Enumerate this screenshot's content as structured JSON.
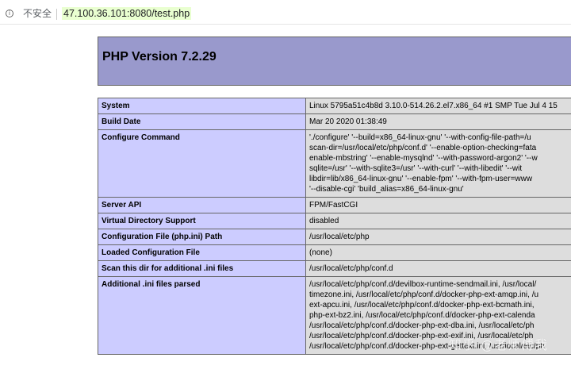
{
  "browser": {
    "security_label": "不安全",
    "url": "47.100.36.101:8080/test.php"
  },
  "page": {
    "title": "PHP Version 7.2.29",
    "rows": [
      {
        "key": "System",
        "value": "Linux 5795a51c4b8d 3.10.0-514.26.2.el7.x86_64 #1 SMP Tue Jul 4 15"
      },
      {
        "key": "Build Date",
        "value": "Mar 20 2020 01:38:49"
      },
      {
        "key": "Configure Command",
        "value": "'./configure' '--build=x86_64-linux-gnu' '--with-config-file-path=/u\nscan-dir=/usr/local/etc/php/conf.d' '--enable-option-checking=fata\nenable-mbstring' '--enable-mysqlnd' '--with-password-argon2' '--w\nsqlite=/usr' '--with-sqlite3=/usr' '--with-curl' '--with-libedit' '--wit\nlibdir=lib/x86_64-linux-gnu' '--enable-fpm' '--with-fpm-user=www\n'--disable-cgi' 'build_alias=x86_64-linux-gnu'"
      },
      {
        "key": "Server API",
        "value": "FPM/FastCGI"
      },
      {
        "key": "Virtual Directory Support",
        "value": "disabled"
      },
      {
        "key": "Configuration File (php.ini) Path",
        "value": "/usr/local/etc/php"
      },
      {
        "key": "Loaded Configuration File",
        "value": "(none)"
      },
      {
        "key": "Scan this dir for additional .ini files",
        "value": "/usr/local/etc/php/conf.d"
      },
      {
        "key": "Additional .ini files parsed",
        "value": "/usr/local/etc/php/conf.d/devilbox-runtime-sendmail.ini, /usr/local/\ntimezone.ini, /usr/local/etc/php/conf.d/docker-php-ext-amqp.ini, /u\next-apcu.ini, /usr/local/etc/php/conf.d/docker-php-ext-bcmath.ini,\nphp-ext-bz2.ini, /usr/local/etc/php/conf.d/docker-php-ext-calenda\n/usr/local/etc/php/conf.d/docker-php-ext-dba.ini, /usr/local/etc/ph\n/usr/local/etc/php/conf.d/docker-php-ext-exif.ini, /usr/local/etc/ph\n/usr/local/etc/php/conf.d/docker-php-ext-gettext.ini, /usr/local/etc/ph"
      }
    ]
  },
  "watermark": "知乎 @老师傅我"
}
